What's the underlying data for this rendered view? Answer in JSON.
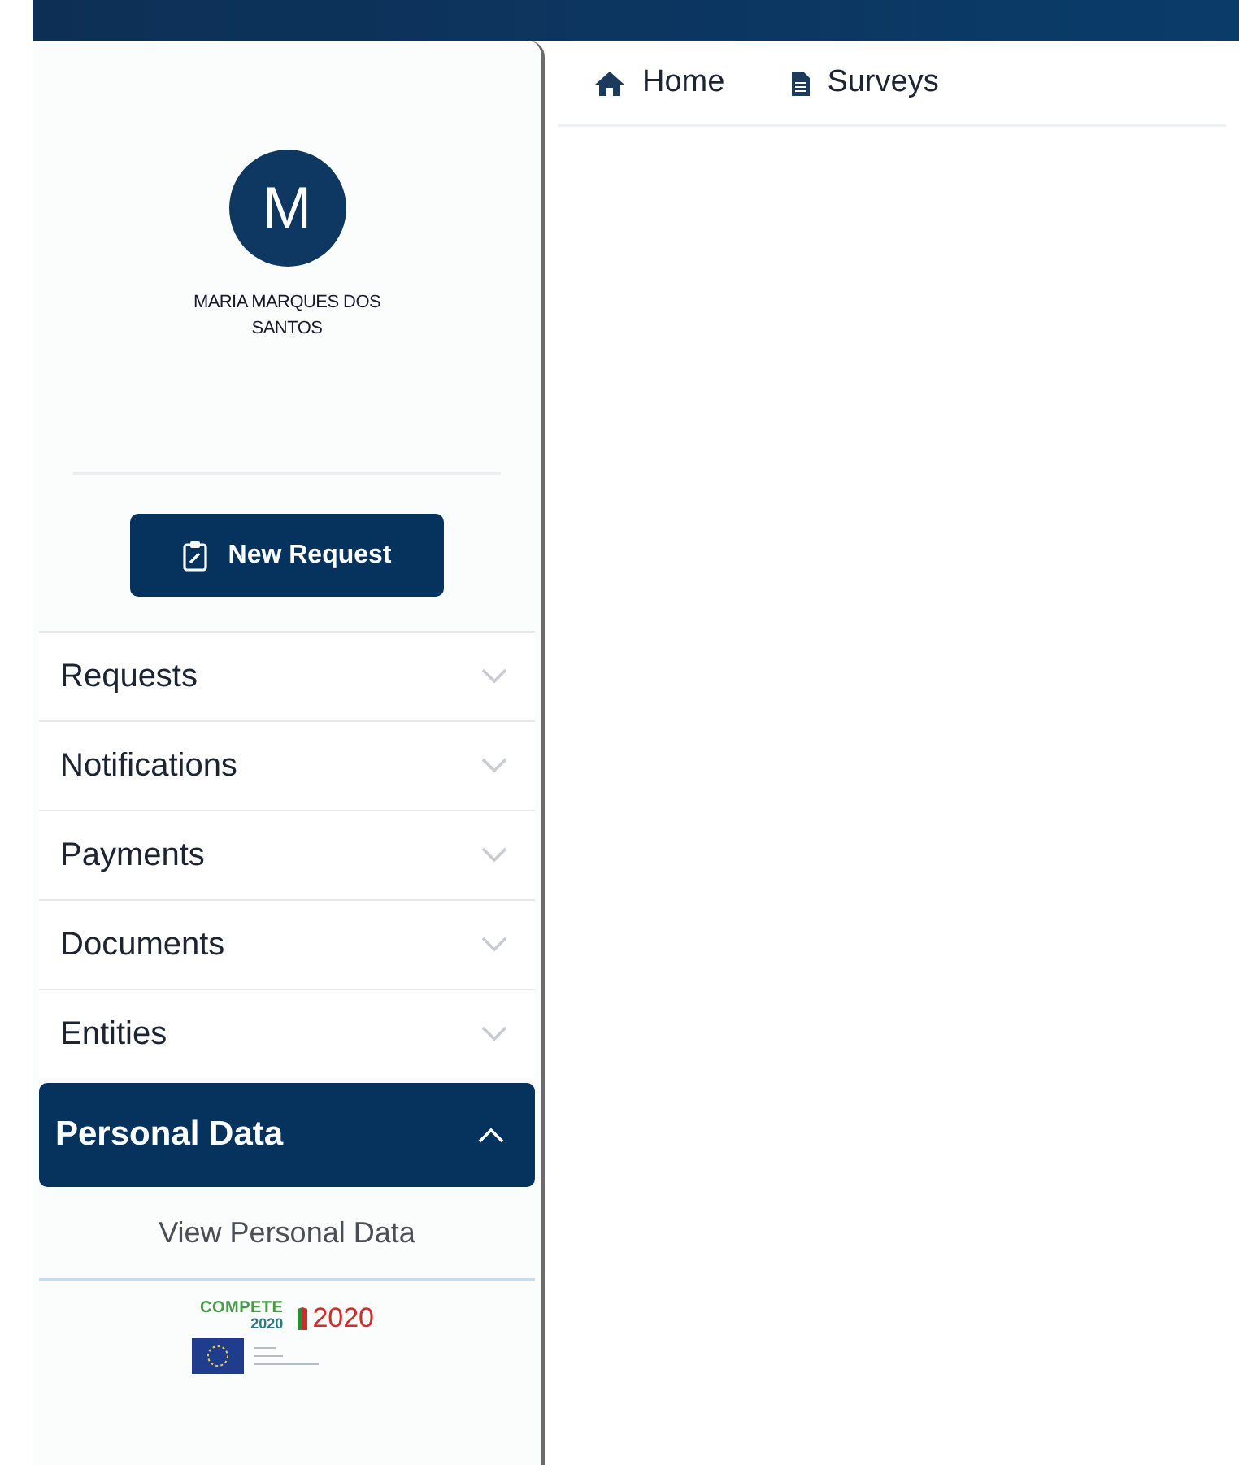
{
  "user": {
    "initial": "M",
    "name": "MARIA MARQUES DOS SANTOS"
  },
  "new_request_button": {
    "label": "New Request"
  },
  "menu": [
    {
      "label": "Requests",
      "expanded": false
    },
    {
      "label": "Notifications",
      "expanded": false
    },
    {
      "label": "Payments",
      "expanded": false
    },
    {
      "label": "Documents",
      "expanded": false
    },
    {
      "label": "Entities",
      "expanded": false
    },
    {
      "label": "Personal Data",
      "expanded": true,
      "children": [
        {
          "label": "View Personal Data"
        }
      ]
    }
  ],
  "footer_logos": {
    "compete": "COMPETE",
    "compete_year": "2020",
    "portugal_year": "2020"
  },
  "top_nav": [
    {
      "kind": "home",
      "label": "Home"
    },
    {
      "kind": "document",
      "label": "Surveys"
    }
  ]
}
